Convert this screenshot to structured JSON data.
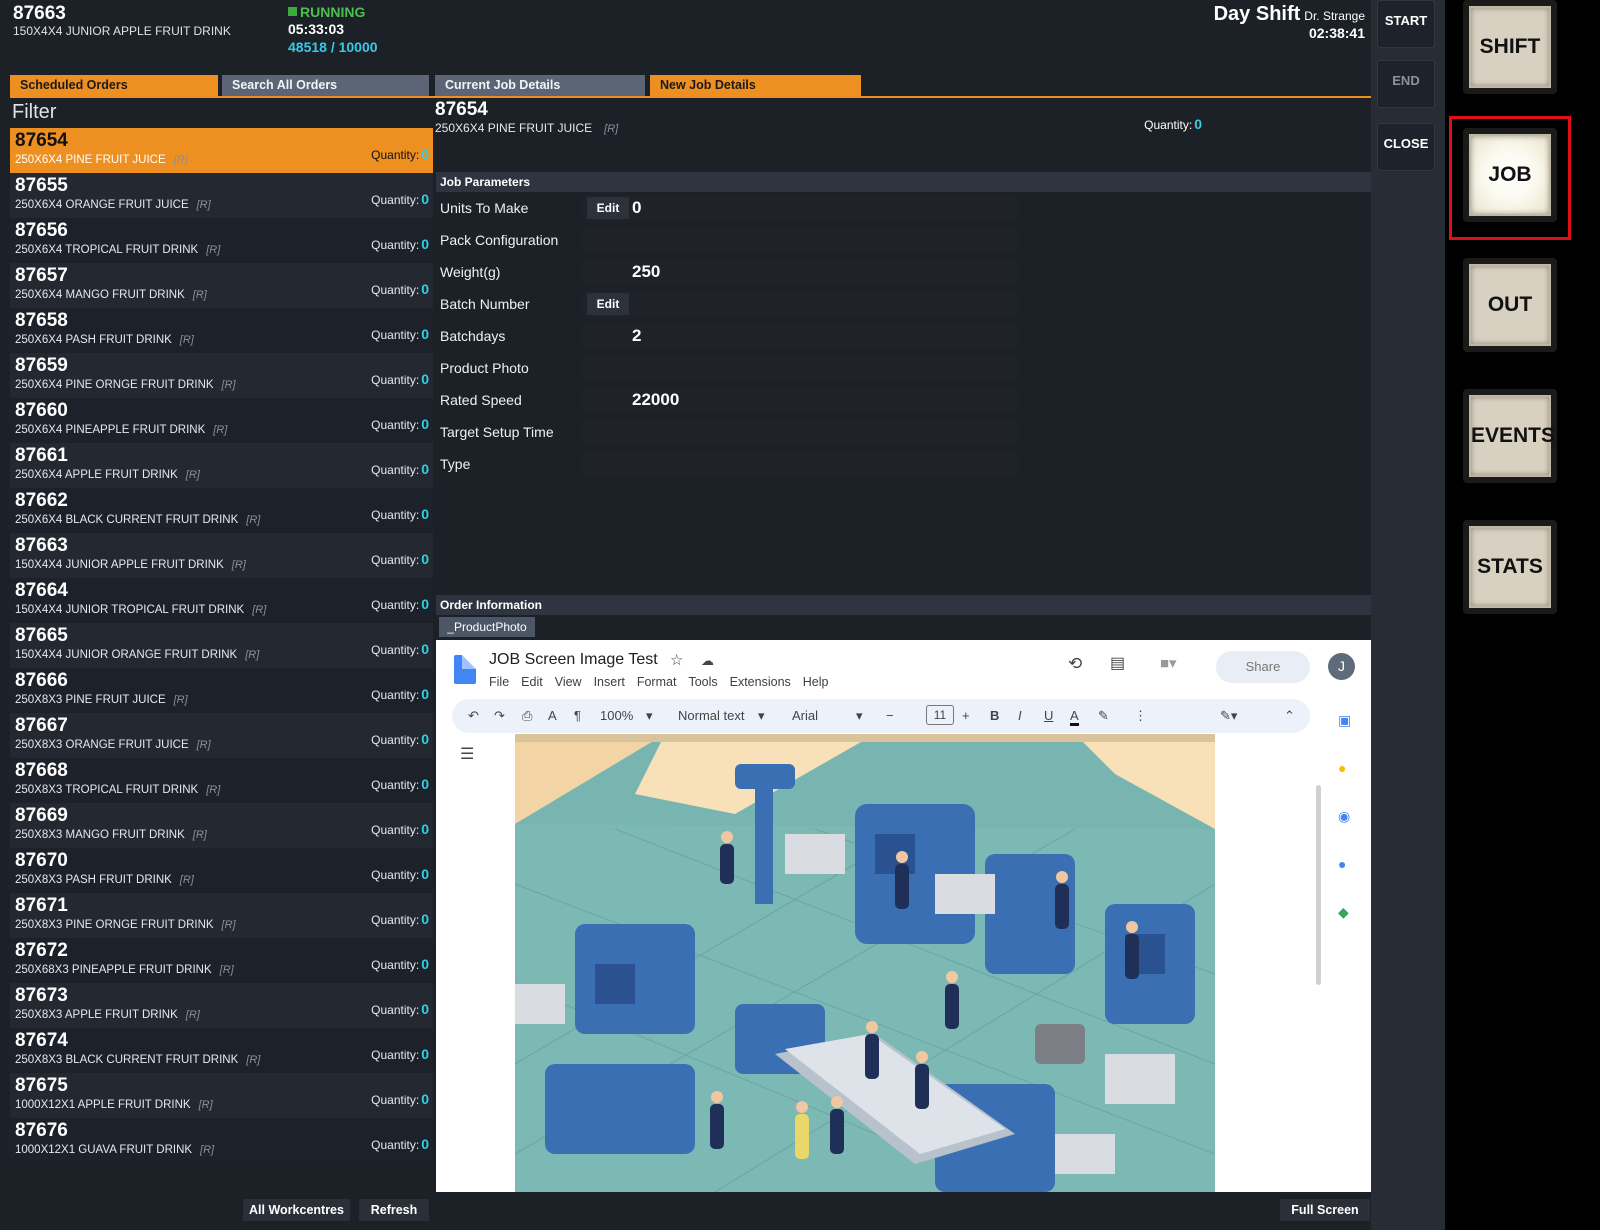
{
  "header": {
    "job_number": "87663",
    "job_desc": "150X4X4 JUNIOR APPLE FRUIT DRINK",
    "status": "RUNNING",
    "run_time": "05:33:03",
    "count": "48518 / 10000",
    "shift": "Day Shift",
    "operator": "Dr. Strange",
    "clock": "02:38:41"
  },
  "side_actions": {
    "start": "START",
    "end": "END",
    "close": "CLOSE"
  },
  "nav_buttons": {
    "shift": "SHIFT",
    "job": "JOB",
    "out": "OUT",
    "events": "EVENTS",
    "stats": "STATS"
  },
  "tabs": {
    "scheduled": "Scheduled Orders",
    "search": "Search All Orders",
    "current": "Current Job Details",
    "new": "New Job Details"
  },
  "filter_label": "Filter",
  "quantity_label": "Quantity:",
  "r_flag": "[R]",
  "orders": [
    {
      "num": "87654",
      "desc": "250X6X4 PINE FRUIT JUICE",
      "qty": "0"
    },
    {
      "num": "87655",
      "desc": "250X6X4 ORANGE FRUIT JUICE",
      "qty": "0"
    },
    {
      "num": "87656",
      "desc": "250X6X4 TROPICAL FRUIT DRINK",
      "qty": "0"
    },
    {
      "num": "87657",
      "desc": "250X6X4 MANGO FRUIT DRINK",
      "qty": "0"
    },
    {
      "num": "87658",
      "desc": "250X6X4 PASH FRUIT DRINK",
      "qty": "0"
    },
    {
      "num": "87659",
      "desc": "250X6X4 PINE ORNGE FRUIT DRINK",
      "qty": "0"
    },
    {
      "num": "87660",
      "desc": "250X6X4 PINEAPPLE FRUIT DRINK",
      "qty": "0"
    },
    {
      "num": "87661",
      "desc": "250X6X4 APPLE FRUIT DRINK",
      "qty": "0"
    },
    {
      "num": "87662",
      "desc": "250X6X4 BLACK CURRENT FRUIT DRINK",
      "qty": "0"
    },
    {
      "num": "87663",
      "desc": "150X4X4 JUNIOR APPLE FRUIT DRINK",
      "qty": "0"
    },
    {
      "num": "87664",
      "desc": "150X4X4 JUNIOR TROPICAL FRUIT DRINK",
      "qty": "0"
    },
    {
      "num": "87665",
      "desc": "150X4X4 JUNIOR ORANGE FRUIT DRINK",
      "qty": "0"
    },
    {
      "num": "87666",
      "desc": "250X8X3 PINE FRUIT JUICE",
      "qty": "0"
    },
    {
      "num": "87667",
      "desc": "250X8X3 ORANGE FRUIT JUICE",
      "qty": "0"
    },
    {
      "num": "87668",
      "desc": "250X8X3 TROPICAL FRUIT DRINK",
      "qty": "0"
    },
    {
      "num": "87669",
      "desc": "250X8X3 MANGO FRUIT DRINK",
      "qty": "0"
    },
    {
      "num": "87670",
      "desc": "250X8X3 PASH FRUIT DRINK",
      "qty": "0"
    },
    {
      "num": "87671",
      "desc": "250X8X3 PINE ORNGE FRUIT DRINK",
      "qty": "0"
    },
    {
      "num": "87672",
      "desc": "250X68X3 PINEAPPLE FRUIT DRINK",
      "qty": "0"
    },
    {
      "num": "87673",
      "desc": "250X8X3 APPLE FRUIT DRINK",
      "qty": "0"
    },
    {
      "num": "87674",
      "desc": "250X8X3 BLACK CURRENT FRUIT DRINK",
      "qty": "0"
    },
    {
      "num": "87675",
      "desc": "1000X12X1 APPLE FRUIT DRINK",
      "qty": "0"
    },
    {
      "num": "87676",
      "desc": "1000X12X1 GUAVA FRUIT DRINK",
      "qty": "0"
    }
  ],
  "details": {
    "num": "87654",
    "desc": "250X6X4 PINE FRUIT JUICE",
    "qty": "0",
    "params_header": "Job Parameters",
    "edit_label": "Edit",
    "params": [
      {
        "label": "Units To Make",
        "value": "0"
      },
      {
        "label": "Pack Configuration",
        "value": ""
      },
      {
        "label": "Weight(g)",
        "value": "250"
      },
      {
        "label": "Batch Number",
        "value": ""
      },
      {
        "label": "Batchdays",
        "value": "2"
      },
      {
        "label": "Product Photo",
        "value": ""
      },
      {
        "label": "Rated Speed",
        "value": "22000"
      },
      {
        "label": "Target Setup Time",
        "value": ""
      },
      {
        "label": "Type",
        "value": ""
      }
    ],
    "order_info_header": "Order Information",
    "photo_tab": "_ProductPhoto"
  },
  "gdoc": {
    "title": "JOB Screen Image Test",
    "menu": [
      "File",
      "Edit",
      "View",
      "Insert",
      "Format",
      "Tools",
      "Extensions",
      "Help"
    ],
    "share": "Share",
    "avatar": "J",
    "zoom": "100%",
    "style": "Normal text",
    "font": "Arial",
    "font_size": "11"
  },
  "footer": {
    "workcentres": "All Workcentres",
    "refresh": "Refresh",
    "fullscreen": "Full Screen"
  },
  "colors": {
    "accent": "#ee8f22",
    "running": "#4bc04b",
    "count": "#38c9e8",
    "highlight_outline": "#e0101a"
  }
}
